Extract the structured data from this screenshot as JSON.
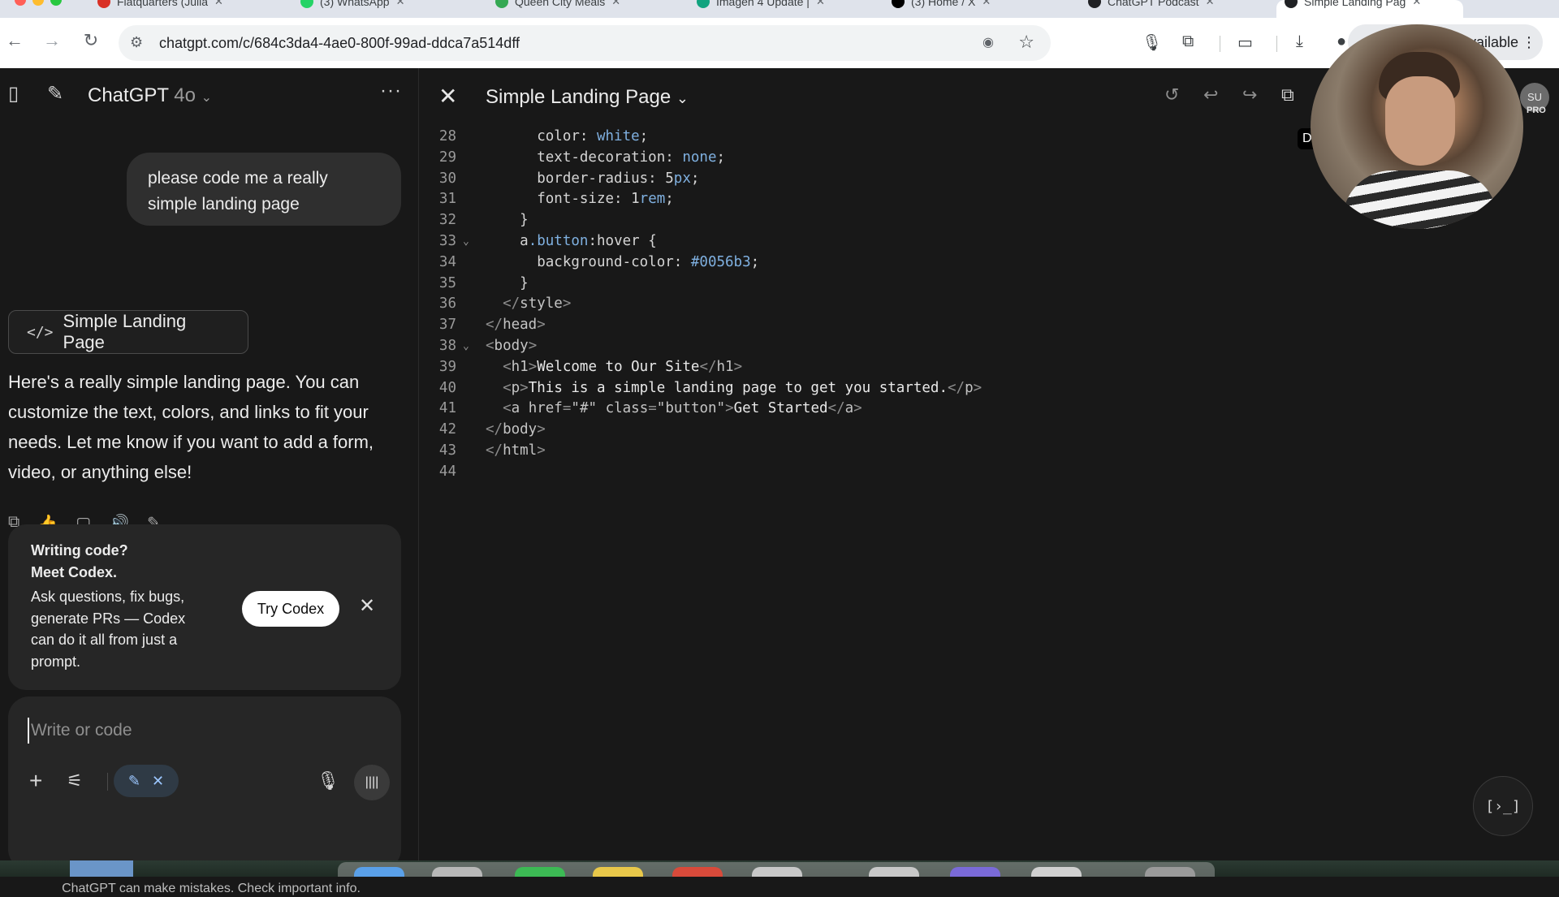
{
  "browser": {
    "tabs": [
      {
        "label": "Flatquarters (Julia",
        "favicon_color": "#d93025"
      },
      {
        "label": "(3) WhatsApp",
        "favicon_color": "#25d366"
      },
      {
        "label": "Queen City Meals",
        "favicon_color": "#34a853"
      },
      {
        "label": "Imagen 4 Update |",
        "favicon_color": "#12a37f"
      },
      {
        "label": "(3) Home / X",
        "favicon_color": "#000000"
      },
      {
        "label": "ChatGPT Podcast",
        "favicon_color": "#202124"
      },
      {
        "label": "Simple Landing Pag",
        "favicon_color": "#202124"
      }
    ],
    "url": "chatgpt.com/c/684c3da4-4ae0-800f-99ad-ddca7a514dff",
    "profile_label": "vailable"
  },
  "sidebar": {
    "model_name": "ChatGPT",
    "model_version": "4o",
    "user_message": "please code me a really simple landing page",
    "artifact_label": "Simple Landing Page",
    "assistant_message": "Here's a really simple landing page. You can customize the text, colors, and links to fit your needs. Let me know if you want to add a form, video, or anything else!",
    "codex": {
      "title_line1": "Writing code?",
      "title_line2": "Meet Codex.",
      "description": "Ask questions, fix bugs, generate PRs — Codex can do it all from just a prompt.",
      "button_label": "Try Codex"
    },
    "composer_placeholder": "Write or code",
    "disclaimer": "ChatGPT can make mistakes. Check important info."
  },
  "editor": {
    "title": "Simple Landing Page",
    "tooltip_fragment": "Do",
    "avatar_initials": "SU",
    "avatar_badge": "PRO",
    "run_label": "[›_]",
    "lines": [
      {
        "n": "28",
        "fold": "",
        "indent": "      ",
        "parts": [
          [
            "c-prop",
            "color: "
          ],
          [
            "c-val",
            "white"
          ],
          [
            "c-prop",
            ";"
          ]
        ]
      },
      {
        "n": "29",
        "fold": "",
        "indent": "      ",
        "parts": [
          [
            "c-prop",
            "text-decoration: "
          ],
          [
            "c-val",
            "none"
          ],
          [
            "c-prop",
            ";"
          ]
        ]
      },
      {
        "n": "30",
        "fold": "",
        "indent": "      ",
        "parts": [
          [
            "c-prop",
            "border-radius: 5"
          ],
          [
            "c-val",
            "px"
          ],
          [
            "c-prop",
            ";"
          ]
        ]
      },
      {
        "n": "31",
        "fold": "",
        "indent": "      ",
        "parts": [
          [
            "c-prop",
            "font-size: 1"
          ],
          [
            "c-val",
            "rem"
          ],
          [
            "c-prop",
            ";"
          ]
        ]
      },
      {
        "n": "32",
        "fold": "",
        "indent": "    ",
        "parts": [
          [
            "c-sel",
            "}"
          ]
        ]
      },
      {
        "n": "33",
        "fold": "⌄",
        "indent": "    ",
        "parts": [
          [
            "c-sel",
            "a"
          ],
          [
            "c-val",
            ".button"
          ],
          [
            "c-sel",
            ":hover {"
          ]
        ]
      },
      {
        "n": "34",
        "fold": "",
        "indent": "      ",
        "parts": [
          [
            "c-prop",
            "background-color: "
          ],
          [
            "c-val",
            "#0056b3"
          ],
          [
            "c-prop",
            ";"
          ]
        ]
      },
      {
        "n": "35",
        "fold": "",
        "indent": "    ",
        "parts": [
          [
            "c-sel",
            "}"
          ]
        ]
      },
      {
        "n": "36",
        "fold": "",
        "indent": "  ",
        "parts": [
          [
            "c-tag",
            "</"
          ],
          [
            "c-tagname",
            "style"
          ],
          [
            "c-tag",
            ">"
          ]
        ]
      },
      {
        "n": "37",
        "fold": "",
        "indent": "",
        "parts": [
          [
            "c-tag",
            "</"
          ],
          [
            "c-tagname",
            "head"
          ],
          [
            "c-tag",
            ">"
          ]
        ]
      },
      {
        "n": "38",
        "fold": "⌄",
        "indent": "",
        "parts": [
          [
            "c-tag",
            "<"
          ],
          [
            "c-tagname",
            "body"
          ],
          [
            "c-tag",
            ">"
          ]
        ]
      },
      {
        "n": "39",
        "fold": "",
        "indent": "  ",
        "parts": [
          [
            "c-tag",
            "<"
          ],
          [
            "c-tagname",
            "h1"
          ],
          [
            "c-tag",
            ">"
          ],
          [
            "c-text",
            "Welcome to Our Site"
          ],
          [
            "c-tag",
            "</"
          ],
          [
            "c-tagname",
            "h1"
          ],
          [
            "c-tag",
            ">"
          ]
        ]
      },
      {
        "n": "40",
        "fold": "",
        "indent": "  ",
        "parts": [
          [
            "c-tag",
            "<"
          ],
          [
            "c-tagname",
            "p"
          ],
          [
            "c-tag",
            ">"
          ],
          [
            "c-text",
            "This is a simple landing page to get you started."
          ],
          [
            "c-tag",
            "</"
          ],
          [
            "c-tagname",
            "p"
          ],
          [
            "c-tag",
            ">"
          ]
        ]
      },
      {
        "n": "41",
        "fold": "",
        "indent": "  ",
        "parts": [
          [
            "c-tag",
            "<"
          ],
          [
            "c-tagname",
            "a "
          ],
          [
            "c-attr",
            "href"
          ],
          [
            "c-tag",
            "="
          ],
          [
            "c-str",
            "\"#\" "
          ],
          [
            "c-attr",
            "class"
          ],
          [
            "c-tag",
            "="
          ],
          [
            "c-str",
            "\"button\""
          ],
          [
            "c-tag",
            ">"
          ],
          [
            "c-text",
            "Get Started"
          ],
          [
            "c-tag",
            "</"
          ],
          [
            "c-tagname",
            "a"
          ],
          [
            "c-tag",
            ">"
          ]
        ]
      },
      {
        "n": "42",
        "fold": "",
        "indent": "",
        "parts": [
          [
            "c-tag",
            "</"
          ],
          [
            "c-tagname",
            "body"
          ],
          [
            "c-tag",
            ">"
          ]
        ]
      },
      {
        "n": "43",
        "fold": "",
        "indent": "",
        "parts": [
          [
            "c-tag",
            "</"
          ],
          [
            "c-tagname",
            "html"
          ],
          [
            "c-tag",
            ">"
          ]
        ]
      },
      {
        "n": "44",
        "fold": "",
        "indent": "",
        "parts": []
      }
    ]
  }
}
